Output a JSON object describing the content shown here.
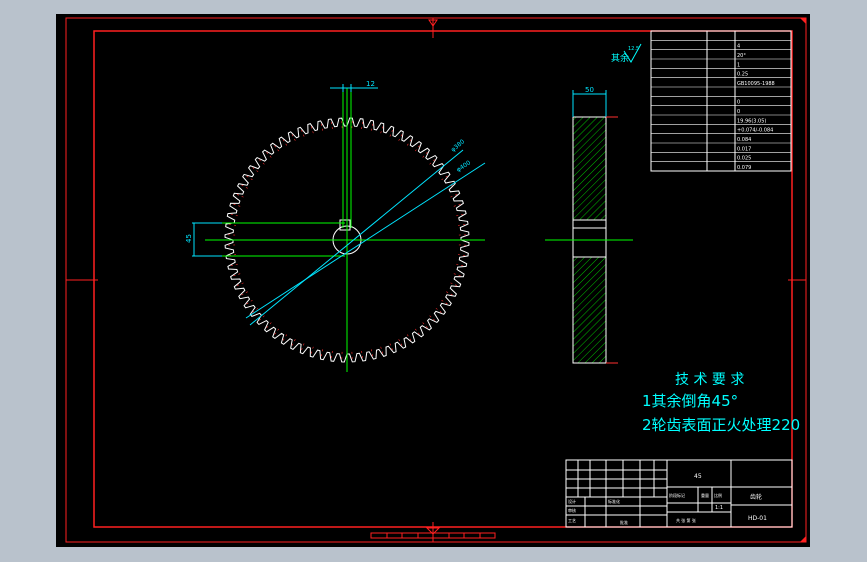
{
  "colors": {
    "window_bg": "#b9c2cc",
    "canvas_bg": "#000000",
    "border": "#ff2020",
    "gear_outline": "#ffffff",
    "centerline": "#00ff00",
    "dimension": "#00e5ff",
    "hatch": "#00c000",
    "text_cyan": "#00ffff",
    "table_lines": "#ffffff"
  },
  "gear": {
    "tooth_count": 72,
    "hatch_pattern": "diagonal"
  },
  "dimensions": {
    "top_width": "12",
    "left_height": "45",
    "side_width": "50",
    "dia1": "φ380",
    "dia2": "φ400"
  },
  "surface_note": {
    "label": "其余",
    "value": "12.5"
  },
  "technical_requirements": {
    "title": "技 术 要 求",
    "line1": "1其余倒角45°",
    "line2": "2轮齿表面正火处理220"
  },
  "param_table": [
    [
      "",
      "",
      ""
    ],
    [
      "",
      "",
      "4"
    ],
    [
      "",
      "",
      "20°"
    ],
    [
      "",
      "",
      "1"
    ],
    [
      "",
      "",
      "0.25"
    ],
    [
      "",
      "",
      "GB10095-1988"
    ],
    [
      "",
      "",
      ""
    ],
    [
      "",
      "",
      "0"
    ],
    [
      "",
      "",
      "0"
    ],
    [
      "",
      "",
      "19.96(3.05)"
    ],
    [
      "",
      "",
      "+0.074/-0.084"
    ],
    [
      "",
      "",
      "0.084"
    ],
    [
      "",
      "",
      "0.017"
    ],
    [
      "",
      "",
      "0.025"
    ],
    [
      "",
      "",
      "0.079"
    ]
  ],
  "title_block": {
    "material": "45",
    "part_name": "齿轮",
    "drawing_no": "HD-01",
    "scale": "1:1",
    "design_label": "设计",
    "check_label": "审核",
    "approve_label": "工艺",
    "std_label": "标准化",
    "approval_label": "批准",
    "stage_label": "阶段标记",
    "weight_label": "重量",
    "scale_label": "比例",
    "sheet_label": "共 张 第 张"
  }
}
